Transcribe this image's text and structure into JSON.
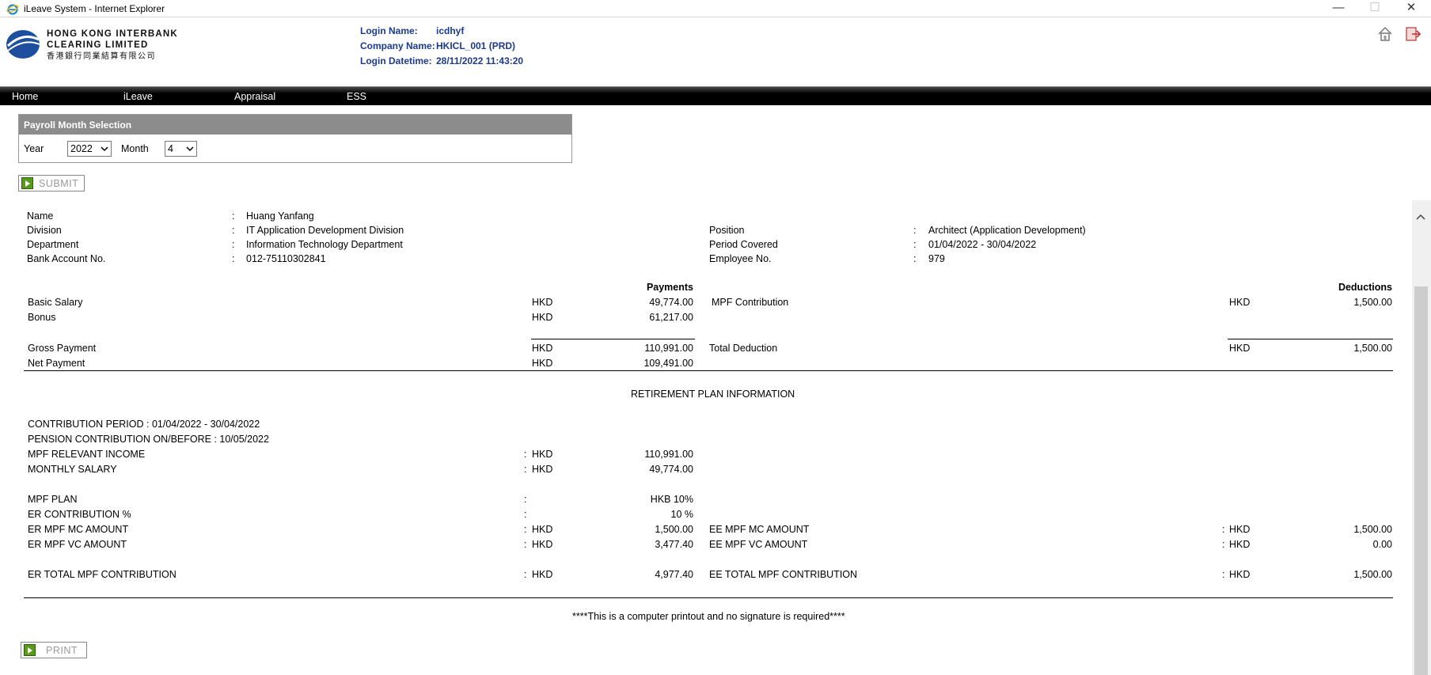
{
  "window": {
    "title": "iLeave System - Internet Explorer",
    "controls": {
      "minimize": "—",
      "maximize": "☐",
      "close": "✕"
    }
  },
  "header": {
    "logo_en_line1": "HONG KONG INTERBANK",
    "logo_en_line2": "CLEARING LIMITED",
    "logo_zh": "香港銀行同業結算有限公司",
    "login_name_label": "Login Name:",
    "login_name_value": "icdhyf",
    "company_name_label": "Company Name:",
    "company_name_value": "HKICL_001 (PRD)",
    "login_datetime_label": "Login Datetime:",
    "login_datetime_value": "28/11/2022 11:43:20",
    "icons": [
      "home-icon",
      "logout-icon"
    ]
  },
  "nav": {
    "items": [
      "Home",
      "iLeave",
      "Appraisal",
      "ESS"
    ]
  },
  "payroll_selection": {
    "title": "Payroll Month Selection",
    "year_label": "Year",
    "year_value": "2022",
    "month_label": "Month",
    "month_value": "4",
    "submit_label": "SUBMIT"
  },
  "employee": {
    "name_label": "Name",
    "name_value": "Huang Yanfang",
    "division_label": "Division",
    "division_value": "IT Application Development Division",
    "department_label": "Department",
    "department_value": "Information Technology Department",
    "bank_label": "Bank Account No.",
    "bank_value": "012-75110302841",
    "position_label": "Position",
    "position_value": "Architect (Application Development)",
    "period_label": "Period Covered",
    "period_value": "01/04/2022 - 30/04/2022",
    "empno_label": "Employee No.",
    "empno_value": "979",
    "colon": ":"
  },
  "payments": {
    "heading": "Payments",
    "currency": "HKD",
    "rows": [
      {
        "label": "Basic Salary",
        "amount": "49,774.00"
      },
      {
        "label": "Bonus",
        "amount": "61,217.00"
      }
    ],
    "gross_label": "Gross Payment",
    "gross_amount": "110,991.00",
    "net_label": "Net Payment",
    "net_amount": "109,491.00"
  },
  "deductions": {
    "heading": "Deductions",
    "rows": [
      {
        "label": "MPF Contribution",
        "amount": "1,500.00"
      }
    ],
    "total_label": "Total Deduction",
    "total_amount": "1,500.00"
  },
  "retirement": {
    "heading": "RETIREMENT PLAN INFORMATION",
    "contribution_period": "CONTRIBUTION PERIOD : 01/04/2022 - 30/04/2022",
    "pension_line": "PENSION CONTRIBUTION ON/BEFORE : 10/05/2022",
    "relevant_income_label": "MPF RELEVANT INCOME",
    "relevant_income_value": "110,991.00",
    "monthly_salary_label": "MONTHLY SALARY",
    "monthly_salary_value": "49,774.00",
    "plan_label": "MPF PLAN",
    "plan_value": "HKB 10%",
    "er_pct_label": "ER CONTRIBUTION %",
    "er_pct_value": "10 %",
    "er_mc_label": "ER MPF MC AMOUNT",
    "er_mc_value": "1,500.00",
    "er_vc_label": "ER MPF VC AMOUNT",
    "er_vc_value": "3,477.40",
    "er_total_label": "ER TOTAL MPF CONTRIBUTION",
    "er_total_value": "4,977.40",
    "ee_mc_label": "EE MPF MC AMOUNT",
    "ee_mc_value": "1,500.00",
    "ee_vc_label": "EE MPF VC AMOUNT",
    "ee_vc_value": "0.00",
    "ee_total_label": "EE TOTAL MPF CONTRIBUTION",
    "ee_total_value": "1,500.00"
  },
  "footer": {
    "note": "****This is a computer printout and no signature is required****",
    "print_label": "PRINT"
  }
}
